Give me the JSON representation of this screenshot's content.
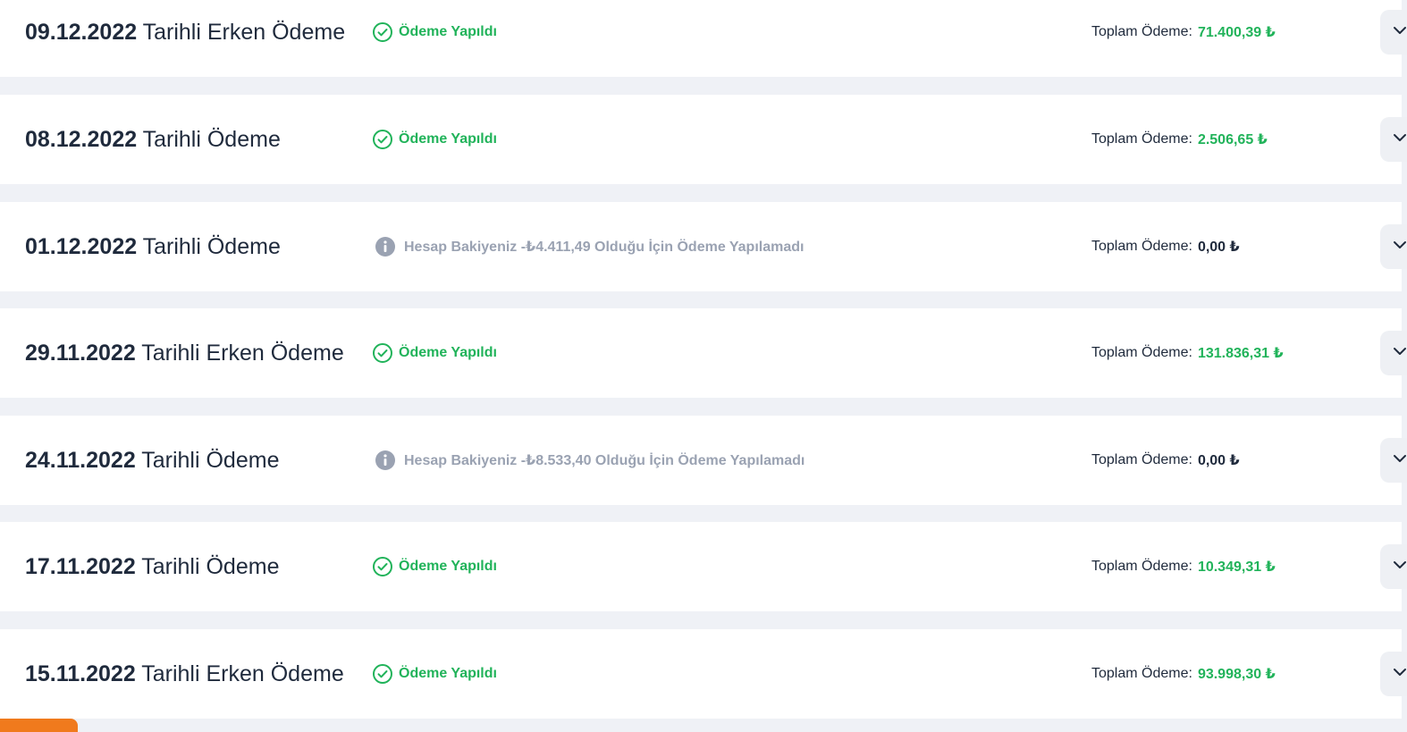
{
  "labels": {
    "total_label": "Toplam Ödeme:",
    "paid_status": "Ödeme Yapıldı"
  },
  "colors": {
    "success": "#21b35a",
    "muted": "#9aa2b2",
    "text": "#1f2a3c",
    "page_bg": "#eff1f6",
    "accent_orange": "#f07a1d"
  },
  "icons": {
    "paid": "check-circle-icon",
    "not_paid": "info-circle-icon",
    "expand": "chevron-down-icon"
  },
  "payments": [
    {
      "date": "09.12.2022",
      "title_rest": " Tarihli Erken Ödeme",
      "status_type": "paid",
      "status_text": "Ödeme Yapıldı",
      "total": "71.400,39 ₺"
    },
    {
      "date": "08.12.2022",
      "title_rest": " Tarihli Ödeme",
      "status_type": "paid",
      "status_text": "Ödeme Yapıldı",
      "total": "2.506,65 ₺"
    },
    {
      "date": "01.12.2022",
      "title_rest": " Tarihli Ödeme",
      "status_type": "not_paid",
      "status_text": "Hesap Bakiyeniz -₺4.411,49 Olduğu İçin Ödeme Yapılamadı",
      "total": "0,00 ₺"
    },
    {
      "date": "29.11.2022",
      "title_rest": " Tarihli Erken Ödeme",
      "status_type": "paid",
      "status_text": "Ödeme Yapıldı",
      "total": "131.836,31 ₺"
    },
    {
      "date": "24.11.2022",
      "title_rest": " Tarihli Ödeme",
      "status_type": "not_paid",
      "status_text": "Hesap Bakiyeniz -₺8.533,40 Olduğu İçin Ödeme Yapılamadı",
      "total": "0,00 ₺"
    },
    {
      "date": "17.11.2022",
      "title_rest": " Tarihli Ödeme",
      "status_type": "paid",
      "status_text": "Ödeme Yapıldı",
      "total": "10.349,31 ₺"
    },
    {
      "date": "15.11.2022",
      "title_rest": " Tarihli Erken Ödeme",
      "status_type": "paid",
      "status_text": "Ödeme Yapıldı",
      "total": "93.998,30 ₺"
    }
  ]
}
